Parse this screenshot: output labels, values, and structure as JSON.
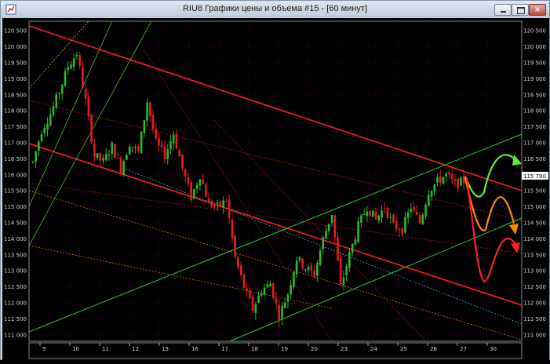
{
  "window": {
    "title": "RIU8 Графики цены и объема #15 - [60 минут]",
    "icons": {
      "app": "chart-app-icon",
      "minimize": "minimize-icon",
      "maximize": "maximize-icon",
      "close": "close-icon"
    },
    "close_glyph": "×"
  },
  "colors": {
    "background": "#000000",
    "bull": "#2db82d",
    "bear": "#e02020",
    "grid": "#500050",
    "channel_red": "#ff2020",
    "channel_green": "#33cc33",
    "arrow_green": "#66ee33",
    "arrow_orange": "#ff8c00",
    "arrow_red": "#ff2020"
  },
  "chart_data": {
    "type": "candlestick",
    "y_ticks": [
      "111 000",
      "111 500",
      "112 000",
      "112 500",
      "113 000",
      "113 500",
      "114 000",
      "114 500",
      "115 000",
      "115 500",
      "116 000",
      "116 500",
      "117 000",
      "117 500",
      "118 000",
      "118 500",
      "119 000",
      "119 500",
      "120 000",
      "120 500"
    ],
    "y_range": [
      110800,
      120800
    ],
    "last_price_label": "115 790",
    "last_price": 115790,
    "x_ticks": [
      "9",
      "10",
      "11",
      "12",
      "13",
      "16",
      "17",
      "18",
      "19",
      "20",
      "23",
      "24",
      "25",
      "26",
      "27",
      "30"
    ],
    "price_path": [
      [
        0,
        116400
      ],
      [
        1,
        117400
      ],
      [
        2,
        117900
      ],
      [
        3,
        118600
      ],
      [
        4,
        119400
      ],
      [
        5,
        119800
      ],
      [
        6,
        118300
      ],
      [
        7,
        116600
      ],
      [
        8,
        116400
      ],
      [
        9,
        116900
      ],
      [
        10,
        116200
      ],
      [
        11,
        117000
      ],
      [
        12,
        116700
      ],
      [
        13,
        118300
      ],
      [
        14,
        117000
      ],
      [
        15,
        116600
      ],
      [
        16,
        117300
      ],
      [
        17,
        116200
      ],
      [
        18,
        115300
      ],
      [
        19,
        116000
      ],
      [
        20,
        115100
      ],
      [
        21,
        115000
      ],
      [
        22,
        115200
      ],
      [
        23,
        113400
      ],
      [
        24,
        112500
      ],
      [
        25,
        111800
      ],
      [
        26,
        112400
      ],
      [
        27,
        112600
      ],
      [
        28,
        111600
      ],
      [
        29,
        112300
      ],
      [
        30,
        113400
      ],
      [
        31,
        113100
      ],
      [
        32,
        112900
      ],
      [
        33,
        114000
      ],
      [
        34,
        114800
      ],
      [
        35,
        112500
      ],
      [
        36,
        113500
      ],
      [
        37,
        114400
      ],
      [
        38,
        115000
      ],
      [
        39,
        114600
      ],
      [
        40,
        115000
      ],
      [
        41,
        114400
      ],
      [
        42,
        114300
      ],
      [
        43,
        115000
      ],
      [
        44,
        114500
      ],
      [
        45,
        115500
      ],
      [
        46,
        115800
      ],
      [
        47,
        116000
      ],
      [
        48,
        115700
      ],
      [
        49,
        115800
      ]
    ],
    "key_values": {
      "high": 120000,
      "low": 111500,
      "last": 115790
    }
  }
}
